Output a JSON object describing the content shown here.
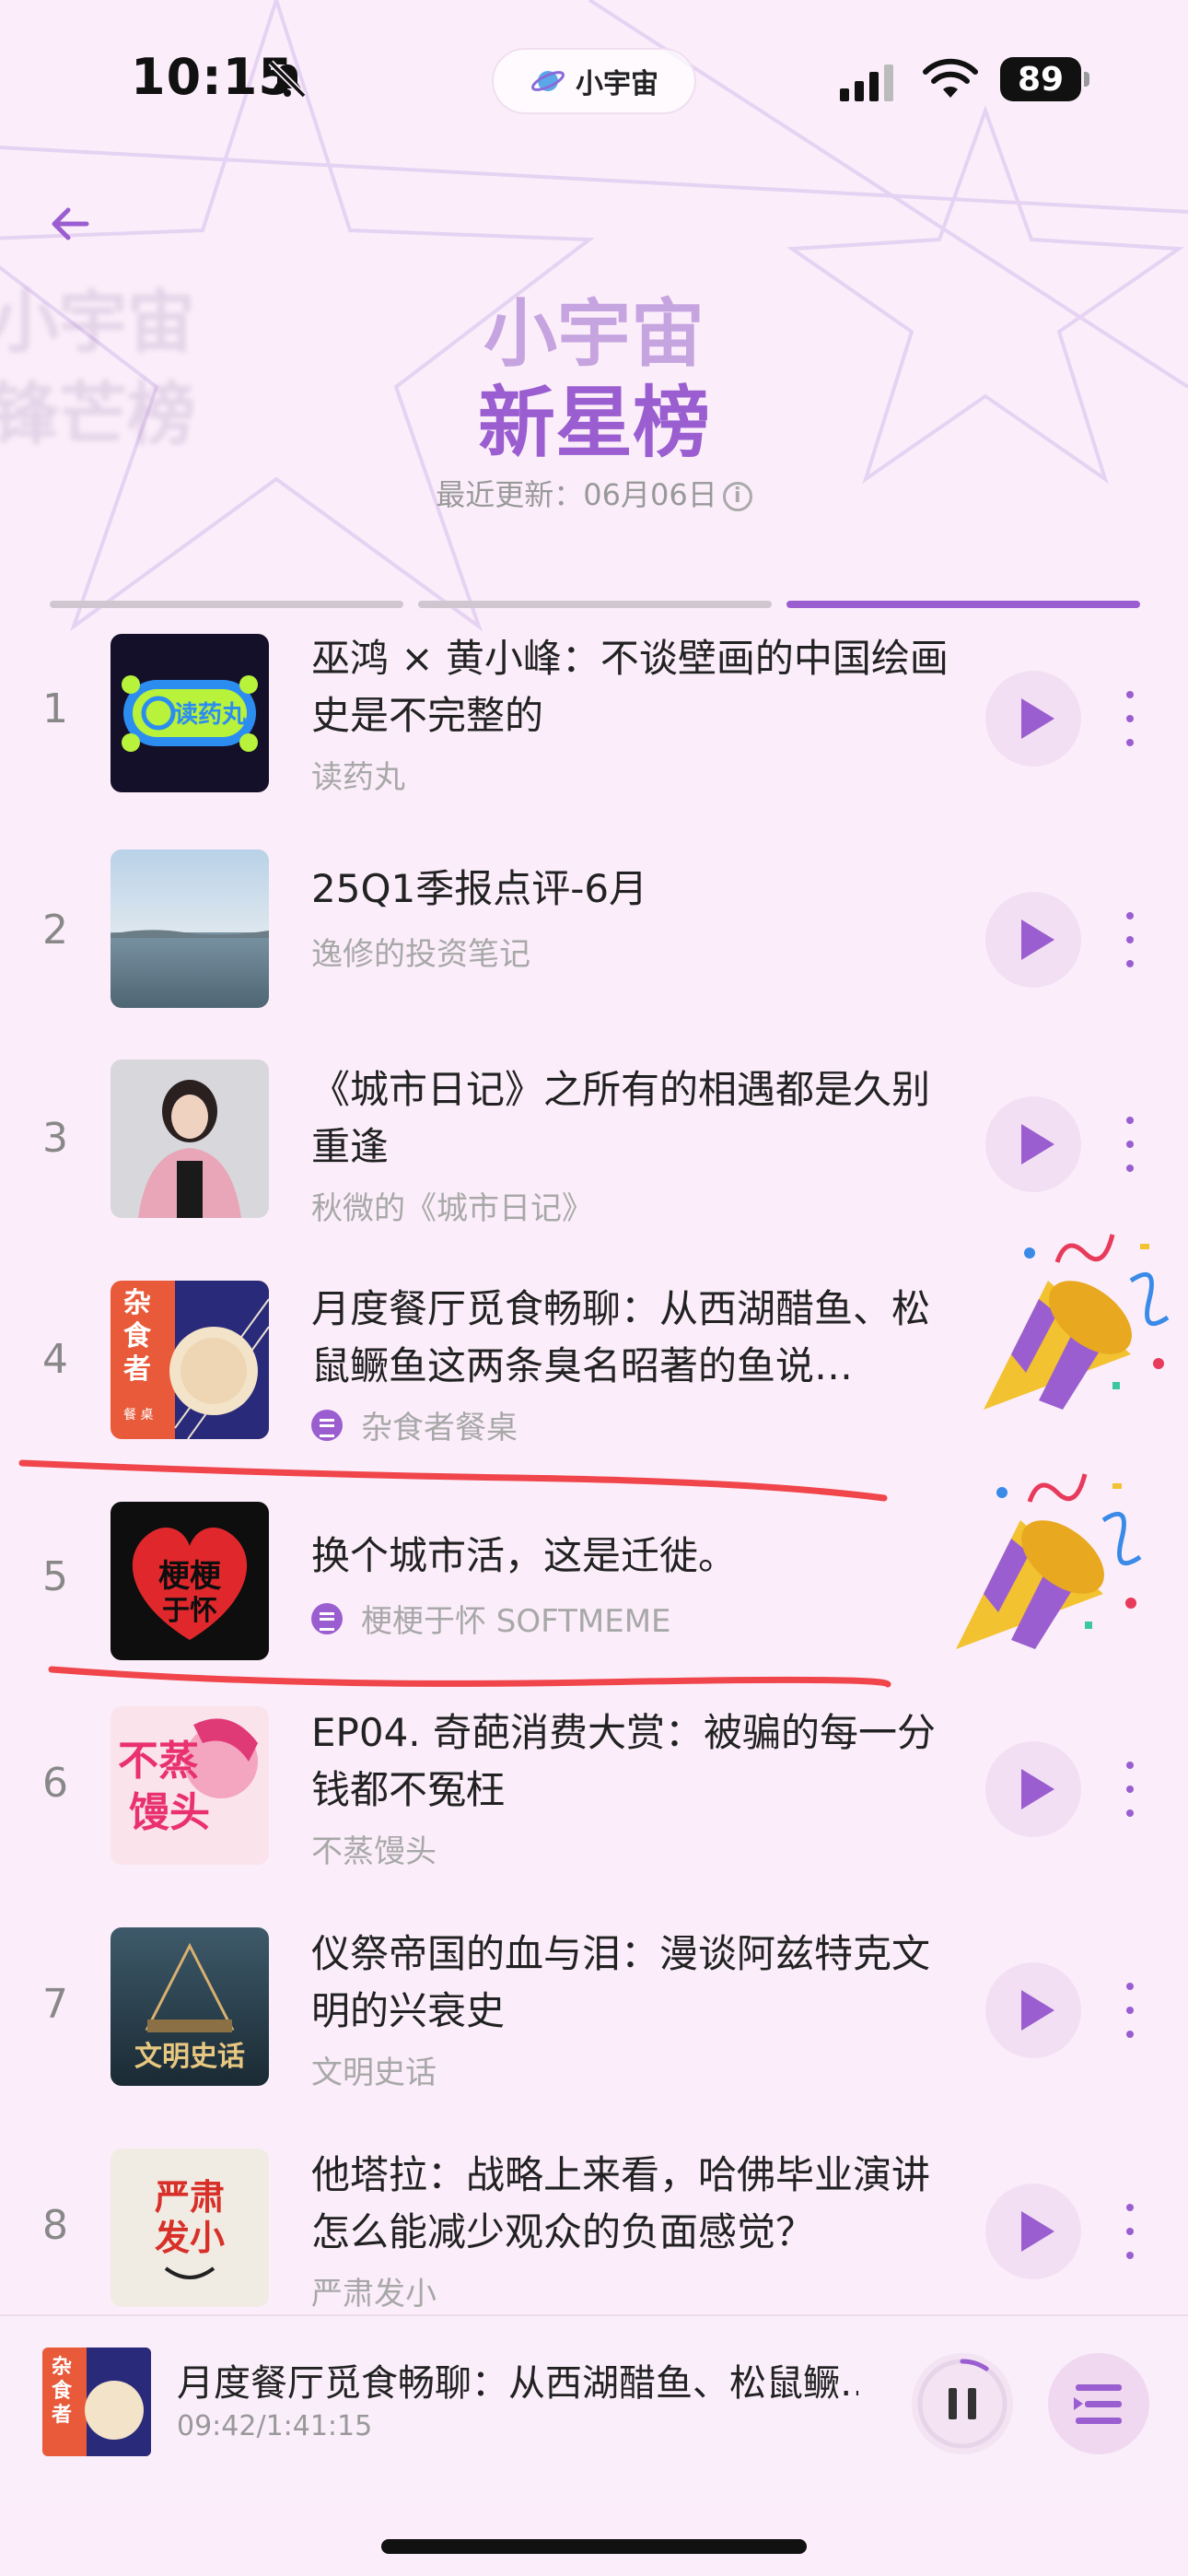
{
  "status": {
    "time": "10:15",
    "battery": "89",
    "app_name": "小宇宙"
  },
  "header": {
    "ghost_line1": "小宇宙",
    "ghost_line2": "锋芒榜",
    "subtitle": "小宇宙",
    "title": "新星榜",
    "update_text": "最近更新：06月06日",
    "info_icon": "i"
  },
  "colors": {
    "accent": "#9a5ed0",
    "annotation": "#f0454a",
    "background": "#fbeefa"
  },
  "tabs": [
    {
      "label": "",
      "active": false
    },
    {
      "label": "",
      "active": false
    },
    {
      "label": "",
      "active": true
    }
  ],
  "episodes": [
    {
      "rank": "1",
      "title": "巫鸿 × 黄小峰：不谈壁画的中国绘画史是不完整的",
      "author": "读药丸",
      "cover_text": "读药丸",
      "podcast_icon": false
    },
    {
      "rank": "2",
      "title": "25Q1季报点评-6月",
      "author": "逸修的投资笔记",
      "cover_text": "",
      "podcast_icon": false
    },
    {
      "rank": "3",
      "title": "《城市日记》之所有的相遇都是久别重逢",
      "author": "秋微的《城市日记》",
      "cover_text": "",
      "podcast_icon": false
    },
    {
      "rank": "4",
      "title": "月度餐厅觅食畅聊：从西湖醋鱼、松鼠鳜鱼这两条臭名昭著的鱼说…",
      "author": "杂食者餐桌",
      "cover_text": "杂食者",
      "podcast_icon": true
    },
    {
      "rank": "5",
      "title": "换个城市活，这是迁徙。",
      "author": "梗梗于怀 SOFTMEME",
      "cover_text": "梗梗于怀",
      "podcast_icon": true
    },
    {
      "rank": "6",
      "title": "EP04. 奇葩消费大赏：被骗的每一分钱都不冤枉",
      "author": "不蒸馒头",
      "cover_text": "不蒸馒头",
      "podcast_icon": false
    },
    {
      "rank": "7",
      "title": "仪祭帝国的血与泪：漫谈阿兹特克文明的兴衰史",
      "author": "文明史话",
      "cover_text": "文明史话",
      "podcast_icon": false
    },
    {
      "rank": "8",
      "title": "他塔拉：战略上来看，哈佛毕业演讲怎么能减少观众的负面感觉？",
      "author": "严肃发小",
      "cover_text": "严肃发小",
      "podcast_icon": false
    }
  ],
  "player": {
    "title": "月度餐厅觅食畅聊：从西湖醋鱼、松鼠鳜…",
    "time": "09:42/1:41:15",
    "cover_text": "杂食者",
    "progress": 0.096
  }
}
